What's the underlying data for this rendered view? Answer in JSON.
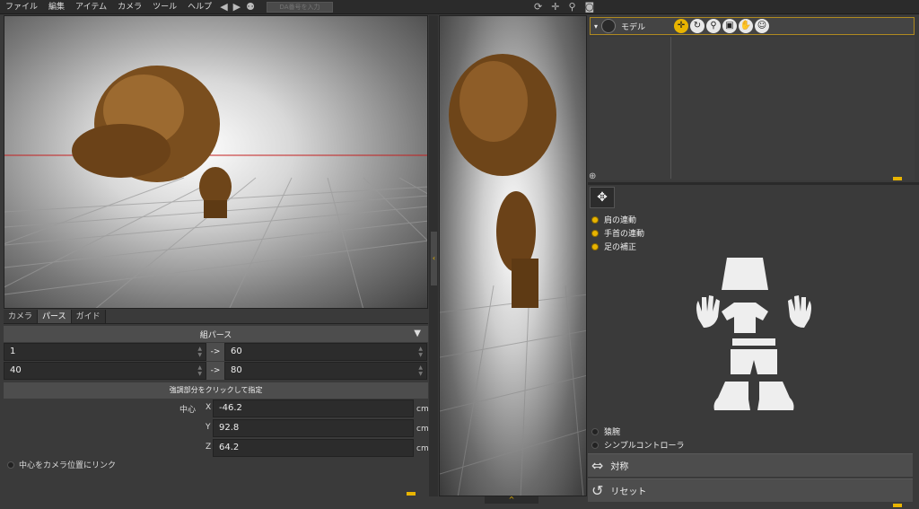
{
  "menu": {
    "items": [
      "ファイル",
      "編集",
      "アイテム",
      "カメラ",
      "ツール",
      "ヘルプ"
    ],
    "da_placeholder": "DA番号を入力",
    "toolbar_icons": [
      "undo-icon",
      "redo-icon",
      "people-icon"
    ],
    "right_icons": [
      "sync-icon",
      "move-icon",
      "zoom-icon",
      "camera-icon"
    ]
  },
  "left_panel": {
    "tabs": [
      "カメラ",
      "パース",
      "ガイド"
    ],
    "active_tab": "パース",
    "dropdown": "組パース",
    "rows": [
      {
        "from": "1",
        "arrow": "->",
        "to": "60"
      },
      {
        "from": "40",
        "arrow": "->",
        "to": "80"
      }
    ],
    "hint": "強調部分をクリックして指定",
    "center_label": "中心",
    "coords": [
      {
        "axis": "X",
        "value": "-46.2",
        "unit": "cm"
      },
      {
        "axis": "Y",
        "value": "92.8",
        "unit": "cm"
      },
      {
        "axis": "Z",
        "value": "64.2",
        "unit": "cm"
      }
    ],
    "link_option": "中心をカメラ位置にリンク"
  },
  "center_panel": {
    "collapse_arrow": "‹",
    "bottom_arrow": "^"
  },
  "right_panel": {
    "model_label": "モデル",
    "options": [
      "肩の連動",
      "手首の連動",
      "足の補正"
    ],
    "bottom_options": [
      "猿腕",
      "シンプルコントローラ"
    ],
    "symmetry_button": "対称",
    "reset_button": "リセット"
  },
  "colors": {
    "accent": "#e8b400",
    "panel_bg": "#3a3a3a",
    "field_bg": "#2c2c2c"
  }
}
